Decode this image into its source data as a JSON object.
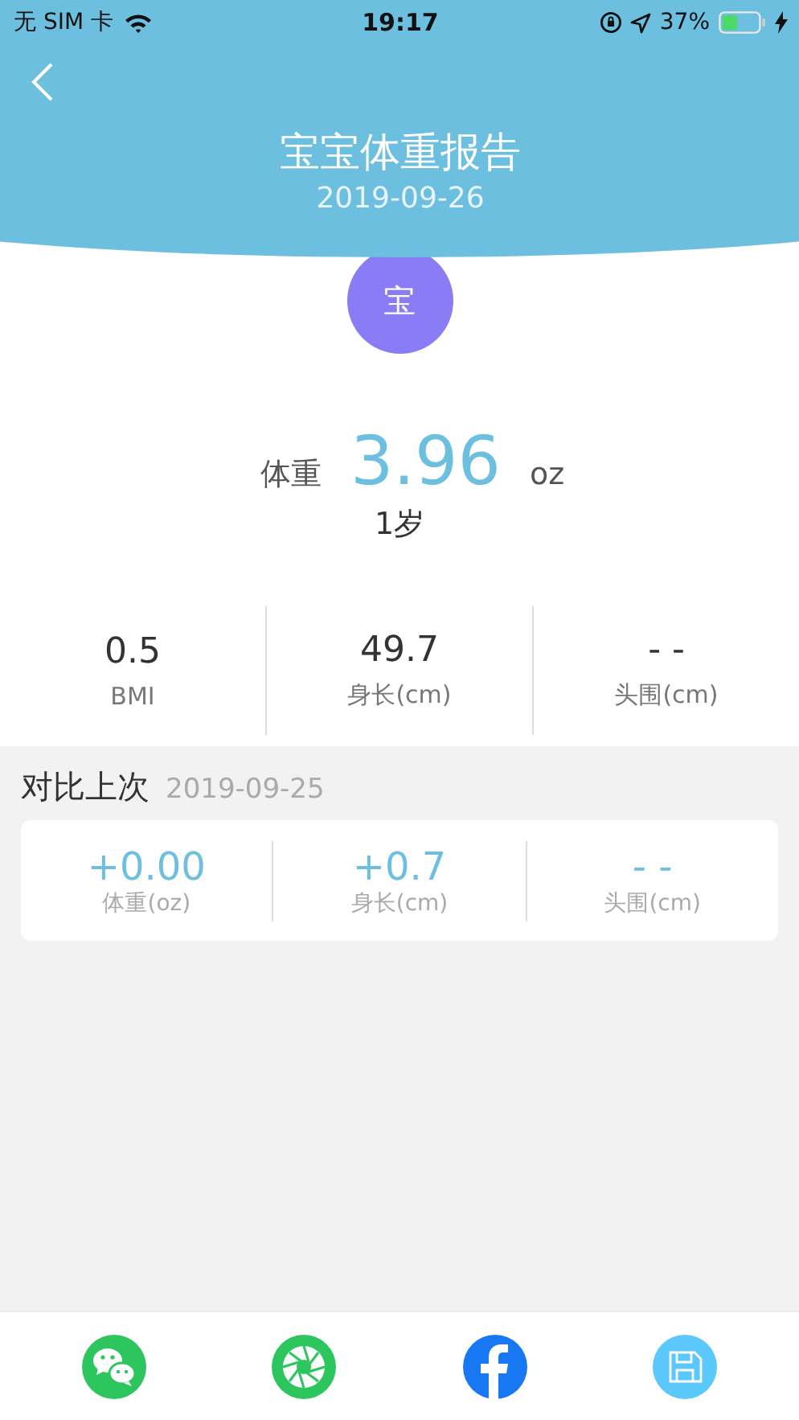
{
  "status_bar": {
    "carrier": "无 SIM 卡",
    "time": "19:17",
    "battery": "37%"
  },
  "header": {
    "title": "宝宝体重报告",
    "date": "2019-09-26"
  },
  "avatar": {
    "text": "宝"
  },
  "weight": {
    "label": "体重",
    "value": "3.96",
    "unit": "oz"
  },
  "age": "1岁",
  "stats": [
    {
      "value": "0.5",
      "label": "BMI"
    },
    {
      "value": "49.7",
      "label": "身长(cm)"
    },
    {
      "value": "- -",
      "label": "头围(cm)"
    }
  ],
  "compare": {
    "title": "对比上次",
    "date": "2019-09-25",
    "items": [
      {
        "value": "+0.00",
        "label": "体重(oz)"
      },
      {
        "value": "+0.7",
        "label": "身长(cm)"
      },
      {
        "value": "- -",
        "label": "头围(cm)"
      }
    ]
  },
  "share_bar": [
    {
      "kind": "wechat"
    },
    {
      "kind": "moments"
    },
    {
      "kind": "facebook"
    },
    {
      "kind": "save"
    }
  ]
}
